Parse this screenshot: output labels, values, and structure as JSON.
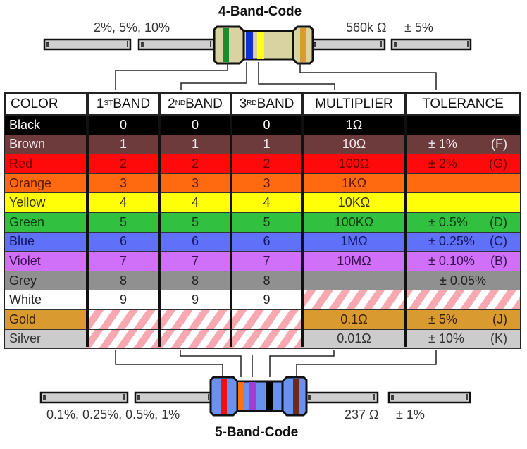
{
  "top_resistor": {
    "title": "4-Band-Code",
    "tolerance_options_label": "2%, 5%, 10%",
    "example_value_label": "560k Ω",
    "example_tolerance_label": "± 5%",
    "body_color": "#d8d3a0",
    "bands": [
      {
        "name": "green",
        "color": "#1e8a2e"
      },
      {
        "name": "blue",
        "color": "#1030d0"
      },
      {
        "name": "yellow",
        "color": "#ffff20"
      },
      {
        "name": "gold",
        "color": "#d99a30"
      }
    ]
  },
  "bottom_resistor": {
    "title": "5-Band-Code",
    "tolerance_options_label": "0.1%, 0.25%, 0.5%, 1%",
    "example_value_label": "237 Ω",
    "example_tolerance_label": "± 1%",
    "body_color": "#6a90f0",
    "bands": [
      {
        "name": "red",
        "color": "#f01010"
      },
      {
        "name": "orange",
        "color": "#ff7010"
      },
      {
        "name": "violet",
        "color": "#a040d0"
      },
      {
        "name": "black",
        "color": "#000000"
      },
      {
        "name": "brown",
        "color": "#6b2a1a"
      }
    ]
  },
  "table": {
    "headers": {
      "color": "COLOR",
      "band1_num": "1",
      "band1_sup": "ST",
      "band1_word": " BAND",
      "band2_num": "2",
      "band2_sup": "ND",
      "band2_word": " BAND",
      "band3_num": "3",
      "band3_sup": "RD",
      "band3_word": " BAND",
      "multiplier": "MULTIPLIER",
      "tolerance": "TOLERANCE"
    },
    "rows": [
      {
        "color": "Black",
        "bg": "#000000",
        "fg": "#ffffff",
        "b1": "0",
        "b2": "0",
        "b3": "0",
        "multiplier": "1Ω",
        "tol": "",
        "code": ""
      },
      {
        "color": "Brown",
        "bg": "#6e3b3d",
        "fg": "#f0e8e8",
        "b1": "1",
        "b2": "1",
        "b3": "1",
        "multiplier": "10Ω",
        "tol": "± 1%",
        "code": "(F)"
      },
      {
        "color": "Red",
        "bg": "#ff0a0a",
        "fg": "#6a0000",
        "b1": "2",
        "b2": "2",
        "b3": "2",
        "multiplier": "100Ω",
        "tol": "± 2%",
        "code": "(G)"
      },
      {
        "color": "Orange",
        "bg": "#ff6a10",
        "fg": "#5a1800",
        "b1": "3",
        "b2": "3",
        "b3": "3",
        "multiplier": "1KΩ",
        "tol": "",
        "code": ""
      },
      {
        "color": "Yellow",
        "bg": "#ffff08",
        "fg": "#333300",
        "b1": "4",
        "b2": "4",
        "b3": "4",
        "multiplier": "10KΩ",
        "tol": "",
        "code": ""
      },
      {
        "color": "Green",
        "bg": "#32c040",
        "fg": "#0a3a10",
        "b1": "5",
        "b2": "5",
        "b3": "5",
        "multiplier": "100KΩ",
        "tol": "± 0.5%",
        "code": "(D)"
      },
      {
        "color": "Blue",
        "bg": "#6070f8",
        "fg": "#101860",
        "b1": "6",
        "b2": "6",
        "b3": "6",
        "multiplier": "1MΩ",
        "tol": "± 0.25%",
        "code": "(C)"
      },
      {
        "color": "Violet",
        "bg": "#d070f8",
        "fg": "#3a1050",
        "b1": "7",
        "b2": "7",
        "b3": "7",
        "multiplier": "10MΩ",
        "tol": "± 0.10%",
        "code": "(B)"
      },
      {
        "color": "Grey",
        "bg": "#909090",
        "fg": "#222222",
        "b1": "8",
        "b2": "8",
        "b3": "8",
        "multiplier": "",
        "tol": "± 0.05%",
        "code": ""
      },
      {
        "color": "White",
        "bg": "#ffffff",
        "fg": "#222222",
        "b1": "9",
        "b2": "9",
        "b3": "9",
        "multiplier": null,
        "tol": null,
        "code": null
      },
      {
        "color": "Gold",
        "bg": "#d99a30",
        "fg": "#3a2200",
        "b1": null,
        "b2": null,
        "b3": null,
        "multiplier": "0.1Ω",
        "tol": "± 5%",
        "code": "(J)"
      },
      {
        "color": "Silver",
        "bg": "#cccccc",
        "fg": "#333333",
        "b1": null,
        "b2": null,
        "b3": null,
        "multiplier": "0.01Ω",
        "tol": "± 10%",
        "code": "(K)"
      }
    ]
  }
}
